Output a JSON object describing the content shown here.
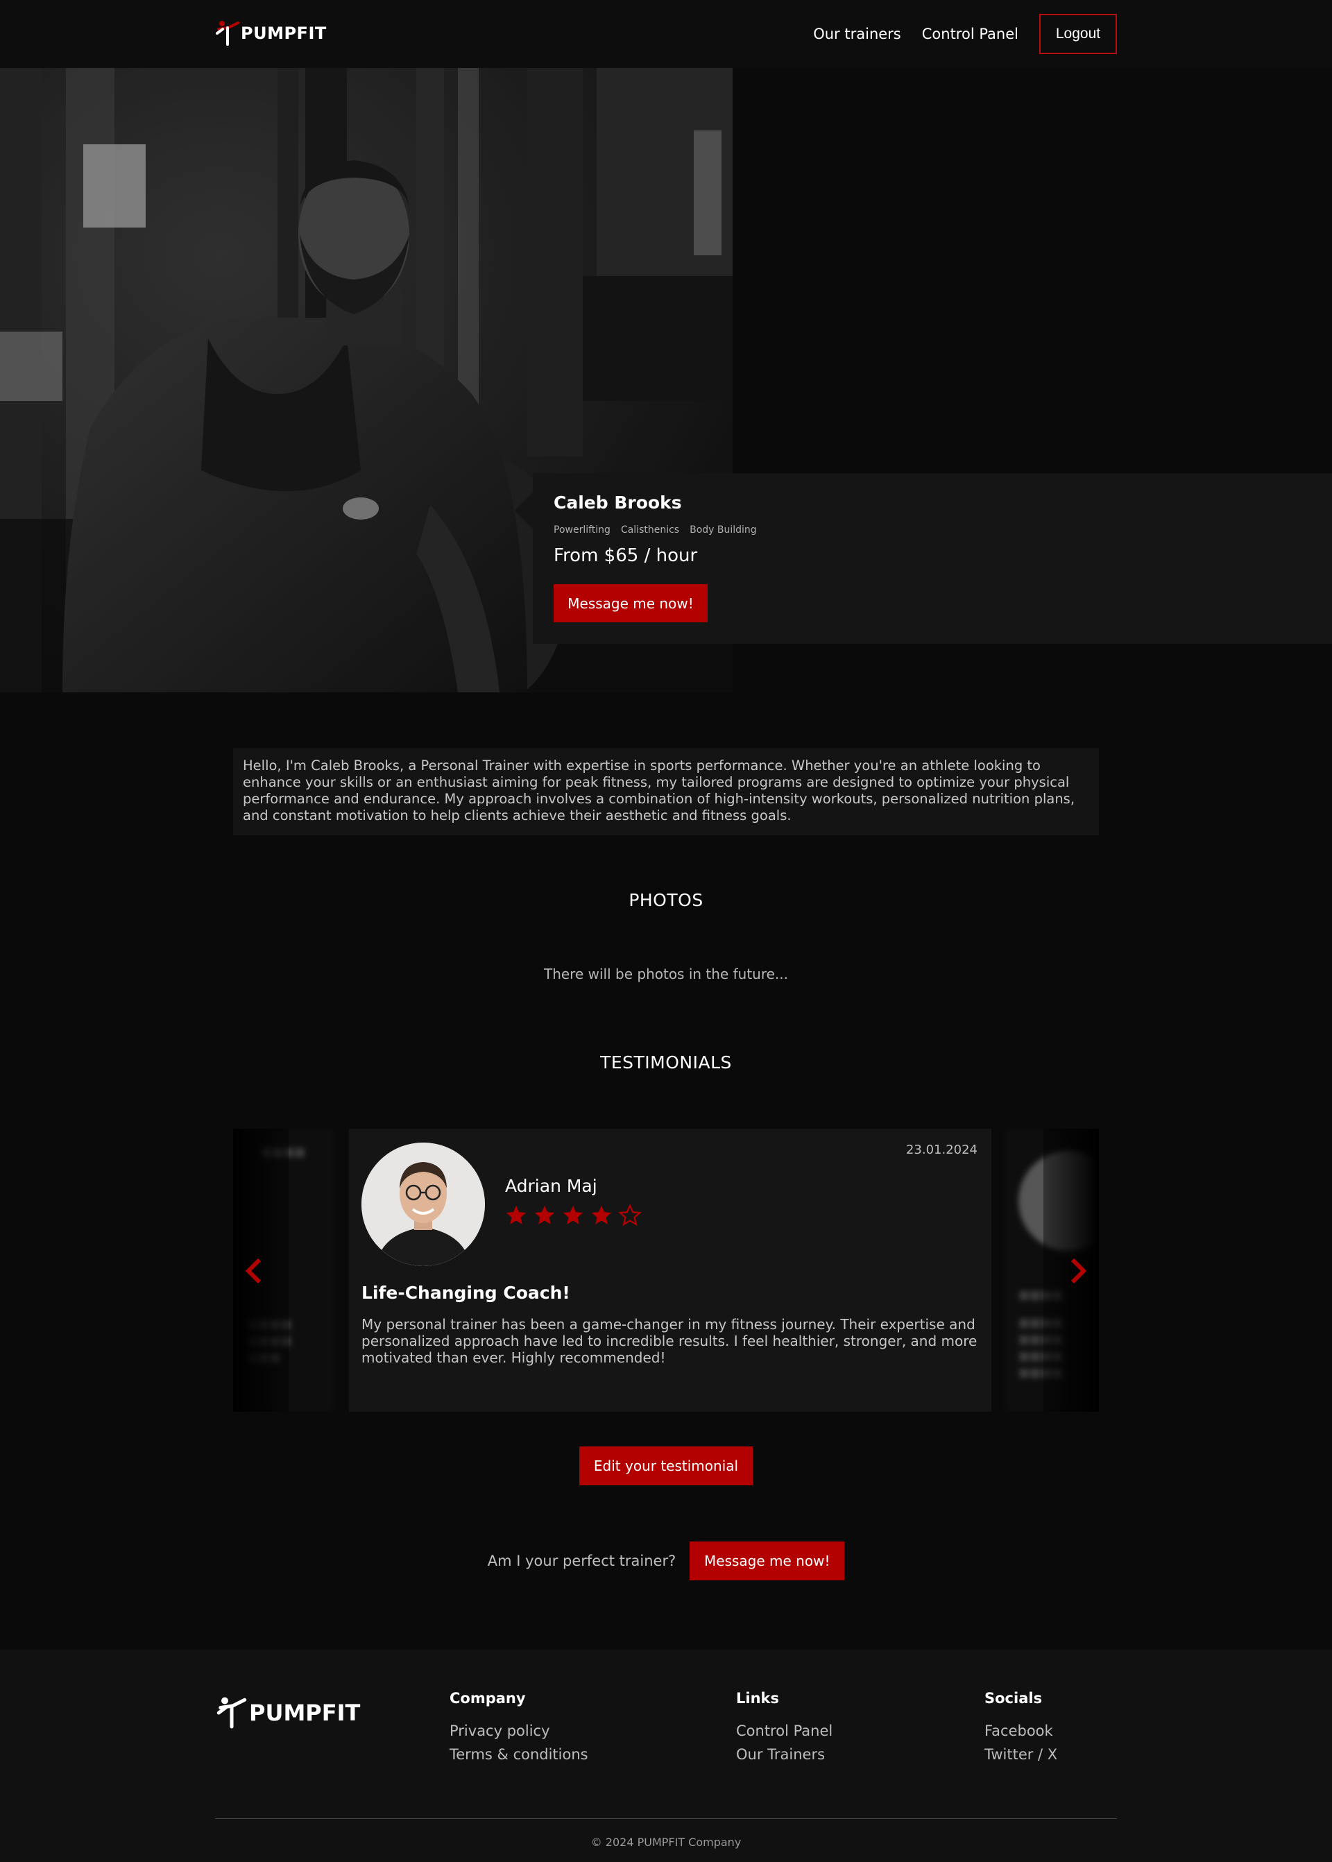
{
  "colors": {
    "accent": "#b30000",
    "background": "#0a0a0a",
    "card": "#151515",
    "footer": "#111111"
  },
  "header": {
    "brand": "PUMPFIT",
    "nav": {
      "trainers": "Our trainers",
      "control_panel": "Control Panel",
      "logout": "Logout"
    }
  },
  "hero": {
    "name": "Caleb Brooks",
    "tags": [
      "Powerlifting",
      "Calisthenics",
      "Body Building"
    ],
    "price": "From $65 / hour",
    "cta": "Message me now!"
  },
  "about": {
    "text": "Hello, I'm Caleb Brooks, a Personal Trainer with expertise in sports performance. Whether you're an athlete looking to enhance your skills or an enthusiast aiming for peak fitness, my tailored programs are designed to optimize your physical performance and endurance. My approach involves a combination of high-intensity workouts, personalized nutrition plans, and constant motivation to help clients achieve their aesthetic and fitness goals."
  },
  "photos": {
    "title": "PHOTOS",
    "empty_note": "There will be photos in the future..."
  },
  "testimonials": {
    "title": "TESTIMONIALS",
    "current": {
      "reviewer": "Adrian Maj",
      "rating": 4,
      "rating_max": 5,
      "date": "23.01.2024",
      "title": "Life-Changing Coach!",
      "text": "My personal trainer has been a game-changer in my fitness journey. Their expertise and personalized approach have led to incredible results. I feel healthier, stronger, and more motivated than ever. Highly recommended!"
    },
    "edit_button": "Edit your testimonial"
  },
  "cta": {
    "question": "Am I your perfect trainer?",
    "button": "Message me now!"
  },
  "footer": {
    "brand": "PUMPFIT",
    "company": {
      "heading": "Company",
      "links": [
        "Privacy policy",
        "Terms & conditions"
      ]
    },
    "links": {
      "heading": "Links",
      "links": [
        "Control Panel",
        "Our Trainers"
      ]
    },
    "socials": {
      "heading": "Socials",
      "links": [
        "Facebook",
        "Twitter / X"
      ]
    },
    "copyright": "© 2024 PUMPFIT Company"
  },
  "icons": {
    "logo": "kicking-figure-icon",
    "prev": "chevron-left-icon",
    "next": "chevron-right-icon",
    "star": "star-icon"
  }
}
